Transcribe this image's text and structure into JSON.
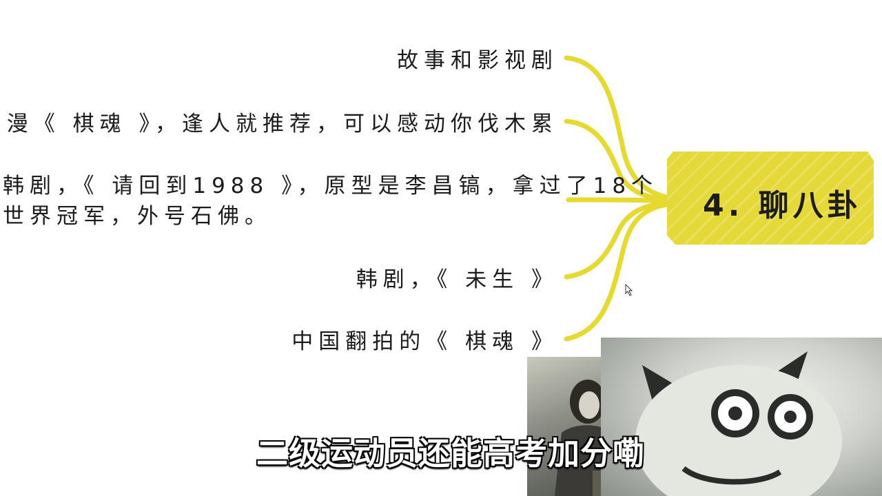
{
  "mindmap": {
    "node_title": "4. 聊八卦",
    "accent_color": "#e5d93a",
    "branches": [
      "故事和影视剧",
      "动漫《 棋魂 》，逢人就推荐，可以感动你伐木累",
      "韩剧，《 请回到1988 》，原型是李昌镐，拿过了18个",
      "世界冠军，外号石佛。",
      "韩剧，《 未生 》",
      "中国翻拍的《 棋魂 》"
    ]
  },
  "video": {
    "subtitle": "二级运动员还能高考加分嘞"
  }
}
